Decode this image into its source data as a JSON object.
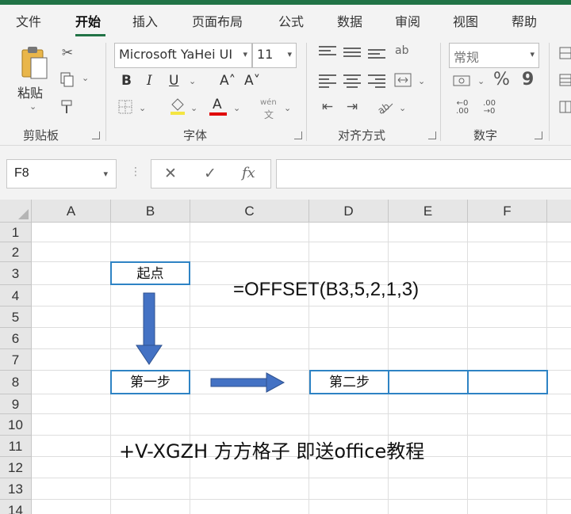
{
  "tabs": [
    {
      "label": "文件"
    },
    {
      "label": "开始",
      "active": true
    },
    {
      "label": "插入"
    },
    {
      "label": "页面布局"
    },
    {
      "label": "公式"
    },
    {
      "label": "数据"
    },
    {
      "label": "审阅"
    },
    {
      "label": "视图"
    },
    {
      "label": "帮助"
    }
  ],
  "ribbon": {
    "clipboard": {
      "paste_label": "粘贴",
      "group_label": "剪贴板"
    },
    "font": {
      "font_name": "Microsoft YaHei UI",
      "font_size": "11",
      "bold": "B",
      "italic": "I",
      "underline": "U",
      "increase_size": "A˄",
      "decrease_size": "A˅",
      "font_color_letter": "A",
      "phonetic": "wén",
      "group_label": "字体"
    },
    "alignment": {
      "group_label": "对齐方式",
      "wrap_text": "ab"
    },
    "number": {
      "format": "常规",
      "percent": "%",
      "comma": "9",
      "group_label": "数字"
    }
  },
  "formula_bar": {
    "name_box": "F8",
    "cancel": "✕",
    "enter": "✓",
    "fx": "fx",
    "formula": ""
  },
  "grid": {
    "columns": [
      "A",
      "B",
      "C",
      "D",
      "E",
      "F"
    ],
    "rows": [
      "1",
      "2",
      "3",
      "4",
      "5",
      "6",
      "7",
      "8",
      "9",
      "10",
      "11",
      "12",
      "13",
      "14"
    ],
    "cells": {
      "B3": "起点",
      "B8": "第一步",
      "D8": "第二步"
    },
    "formula_text": "=OFFSET(B3,5,2,1,3)",
    "promo_text": "+V-XGZH  方方格子 即送office教程"
  },
  "colors": {
    "accent": "#217346",
    "cell_border": "#2e83c4",
    "arrow": "#4472c4",
    "font_color_bar": "#e00000"
  }
}
